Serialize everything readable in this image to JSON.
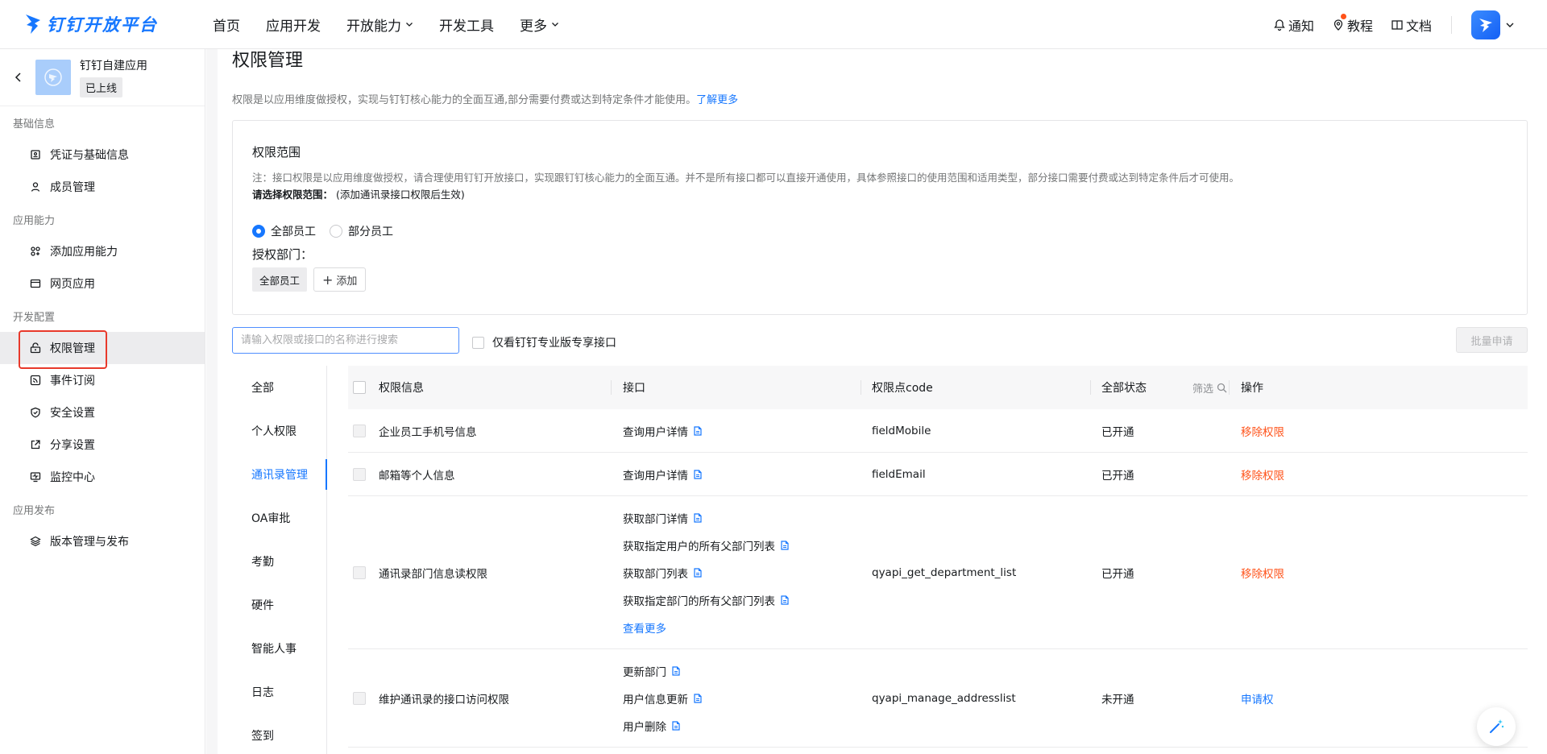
{
  "brand": {
    "name": "钉钉开放平台"
  },
  "nav": {
    "items": [
      {
        "label": "首页",
        "dropdown": false
      },
      {
        "label": "应用开发",
        "dropdown": false
      },
      {
        "label": "开放能力",
        "dropdown": true
      },
      {
        "label": "开发工具",
        "dropdown": false
      },
      {
        "label": "更多",
        "dropdown": true
      }
    ]
  },
  "tools": {
    "notify": "通知",
    "tutorial": "教程",
    "docs": "文档"
  },
  "app": {
    "name": "钉钉自建应用",
    "status": "已上线"
  },
  "sidebar": {
    "groups": [
      {
        "title": "基础信息",
        "items": [
          {
            "label": "凭证与基础信息",
            "icon": "credential-icon"
          },
          {
            "label": "成员管理",
            "icon": "member-icon"
          }
        ]
      },
      {
        "title": "应用能力",
        "items": [
          {
            "label": "添加应用能力",
            "icon": "add-ability-icon"
          },
          {
            "label": "网页应用",
            "icon": "webpage-icon"
          }
        ]
      },
      {
        "title": "开发配置",
        "items": [
          {
            "label": "权限管理",
            "icon": "permission-icon",
            "active": true
          },
          {
            "label": "事件订阅",
            "icon": "event-icon"
          },
          {
            "label": "安全设置",
            "icon": "shield-icon"
          },
          {
            "label": "分享设置",
            "icon": "share-icon"
          },
          {
            "label": "监控中心",
            "icon": "monitor-icon"
          }
        ]
      },
      {
        "title": "应用发布",
        "items": [
          {
            "label": "版本管理与发布",
            "icon": "layers-icon"
          }
        ]
      }
    ]
  },
  "page": {
    "title": "权限管理",
    "desc": "权限是以应用维度做授权，实现与钉钉核心能力的全面互通,部分需要付费或达到特定条件才能使用。",
    "desc_link": "了解更多"
  },
  "scope": {
    "title": "权限范围",
    "note": "注：接口权限是以应用维度做授权，请合理使用钉钉开放接口，实现跟钉钉核心能力的全面互通。并不是所有接口都可以直接开通使用，具体参照接口的使用范围和适用类型，部分接口需要付费或达到特定条件后才可使用。",
    "choose_label": "请选择权限范围：",
    "choose_hint": "(添加通讯录接口权限后生效)",
    "option_all": "全部员工",
    "option_part": "部分员工",
    "dept_label": "授权部门：",
    "dept_chip": "全部员工",
    "add_label": "添加"
  },
  "search": {
    "placeholder": "请输入权限或接口的名称进行搜索"
  },
  "only_pro": "仅看钉钉专业版专享接口",
  "batch_apply": "批量申请",
  "categories": [
    "全部",
    "个人权限",
    "通讯录管理",
    "OA审批",
    "考勤",
    "硬件",
    "智能人事",
    "日志",
    "签到"
  ],
  "active_category": 2,
  "table": {
    "headers": {
      "info": "权限信息",
      "api": "接口",
      "code": "权限点code",
      "status": "全部状态",
      "filter": "筛选",
      "op": "操作"
    },
    "rows": [
      {
        "name": "企业员工手机号信息",
        "apis": [
          "查询用户详情"
        ],
        "code": "fieldMobile",
        "status": "已开通",
        "op": "移除权限",
        "op_type": "remove"
      },
      {
        "name": "邮箱等个人信息",
        "apis": [
          "查询用户详情"
        ],
        "code": "fieldEmail",
        "status": "已开通",
        "op": "移除权限",
        "op_type": "remove"
      },
      {
        "name": "通讯录部门信息读权限",
        "apis": [
          "获取部门详情",
          "获取指定用户的所有父部门列表",
          "获取部门列表",
          "获取指定部门的所有父部门列表"
        ],
        "more": "查看更多",
        "code": "qyapi_get_department_list",
        "status": "已开通",
        "op": "移除权限",
        "op_type": "remove"
      },
      {
        "name": "维护通讯录的接口访问权限",
        "apis": [
          "更新部门",
          "用户信息更新",
          "用户删除"
        ],
        "code": "qyapi_manage_addresslist",
        "status": "未开通",
        "op": "申请权",
        "op_type": "apply"
      }
    ]
  },
  "colors": {
    "accent": "#1677ff",
    "danger": "#ff5219",
    "highlight": "#e8392b"
  }
}
